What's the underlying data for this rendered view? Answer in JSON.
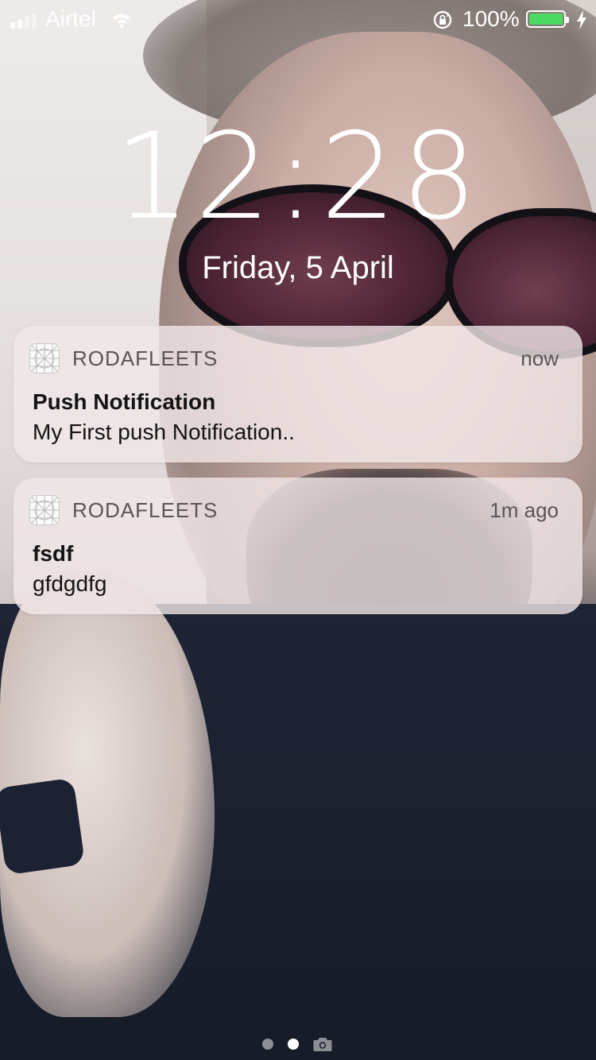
{
  "status_bar": {
    "carrier": "Airtel",
    "battery_percent": "100%",
    "battery_level": 1.0,
    "signal_bars": 2,
    "colors": {
      "battery_fill": "#4cd964"
    }
  },
  "lock_screen": {
    "time": "12:28",
    "date": "Friday, 5 April"
  },
  "notifications": [
    {
      "app": "RODAFLEETS",
      "time": "now",
      "title": "Push Notification",
      "body": "My First push Notification..",
      "icon": "app-grid-icon"
    },
    {
      "app": "RODAFLEETS",
      "time": "1m ago",
      "title": "fsdf",
      "body": "gfdgdfg",
      "icon": "app-grid-icon"
    }
  ],
  "page_indicator": {
    "active_index": 1,
    "pages": 2,
    "icons": [
      "dot",
      "dot",
      "camera-icon"
    ]
  }
}
